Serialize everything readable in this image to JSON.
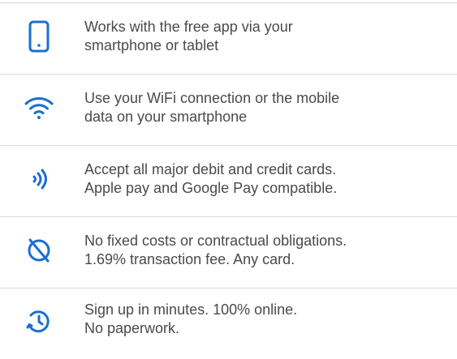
{
  "accent_color": "#1a6fd1",
  "text_color": "#4a4a4a",
  "divider_color": "#dadada",
  "features": [
    {
      "icon": "smartphone-icon",
      "line1": "Works with the free app via your",
      "line2": "smartphone or tablet"
    },
    {
      "icon": "wifi-icon",
      "line1": "Use your WiFi connection or the mobile",
      "line2": "data on your smartphone"
    },
    {
      "icon": "contactless-icon",
      "line1": "Accept all major debit and credit cards.",
      "line2": "Apple pay and Google Pay compatible."
    },
    {
      "icon": "no-fees-icon",
      "line1": "No fixed costs or contractual obligations.",
      "line2": "1.69% transaction fee. Any card."
    },
    {
      "icon": "quick-signup-icon",
      "line1": "Sign up in minutes. 100% online.",
      "line2": "No paperwork."
    }
  ]
}
